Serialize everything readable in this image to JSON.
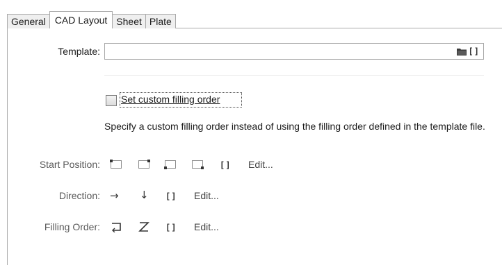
{
  "tabs": [
    "General",
    "CAD Layout",
    "Sheet",
    "Plate"
  ],
  "template": {
    "label": "Template:",
    "value": "",
    "folder_icon": "folder-icon",
    "variable_icon": "[]"
  },
  "custom_order": {
    "checkbox_label": "Set custom filling order",
    "checked": false,
    "description": "Specify a custom filling order instead of using the filling order defined in the template file."
  },
  "start_position": {
    "label": "Start Position:",
    "icons": [
      "top-left-corner-icon",
      "top-right-corner-icon",
      "bottom-left-corner-icon",
      "bottom-right-corner-icon"
    ],
    "variable_icon": "[]",
    "edit_label": "Edit..."
  },
  "direction": {
    "label": "Direction:",
    "right_arrow": "→",
    "down_arrow": "↓",
    "variable_icon": "[]",
    "edit_label": "Edit..."
  },
  "filling_order": {
    "label": "Filling Order:",
    "variable_icon": "[]",
    "edit_label": "Edit..."
  }
}
